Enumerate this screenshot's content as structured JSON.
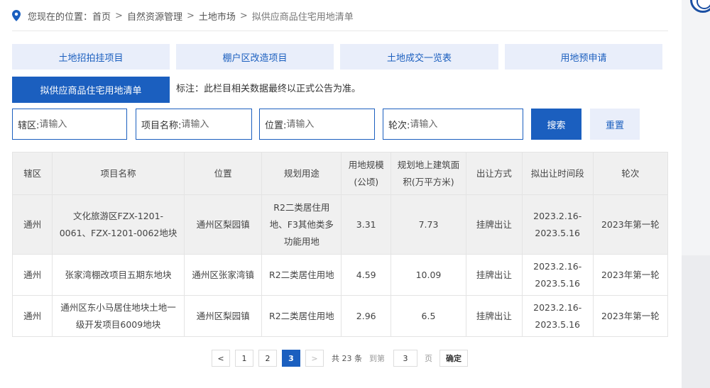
{
  "breadcrumb": {
    "prefix": "您现在的位置：",
    "items": [
      "首页",
      "自然资源管理",
      "土地市场"
    ],
    "current": "拟供应商品住宅用地清单",
    "separator": ">"
  },
  "tabs": [
    {
      "label": "土地招拍挂项目"
    },
    {
      "label": "棚户区改造项目"
    },
    {
      "label": "土地成交一览表"
    },
    {
      "label": "用地预申请"
    },
    {
      "label": "拟供应商品住宅用地清单",
      "active": true
    }
  ],
  "note": "标注：此栏目相关数据最终以正式公告为准。",
  "filters": [
    {
      "label": "辖区:",
      "placeholder": "请输入"
    },
    {
      "label": "项目名称:",
      "placeholder": "请输入"
    },
    {
      "label": "位置:",
      "placeholder": "请输入"
    },
    {
      "label": "轮次:",
      "placeholder": "请输入"
    }
  ],
  "buttons": {
    "search": "搜索",
    "reset": "重置"
  },
  "table": {
    "headers": [
      "辖区",
      "项目名称",
      "位置",
      "规划用途",
      "用地规模(公顷)",
      "规划地上建筑面积(万平方米)",
      "出让方式",
      "拟出让时间段",
      "轮次"
    ],
    "rows": [
      [
        "通州",
        "文化旅游区FZX-1201-0061、FZX-1201-0062地块",
        "通州区梨园镇",
        "R2二类居住用地、F3其他类多功能用地",
        "3.31",
        "7.73",
        "挂牌出让",
        "2023.2.16-2023.5.16",
        "2023年第一轮"
      ],
      [
        "通州",
        "张家湾棚改项目五期东地块",
        "通州区张家湾镇",
        "R2二类居住用地",
        "4.59",
        "10.09",
        "挂牌出让",
        "2023.2.16-2023.5.16",
        "2023年第一轮"
      ],
      [
        "通州",
        "通州区东小马居住地块土地一级开发项目6009地块",
        "通州区梨园镇",
        "R2二类居住用地",
        "2.96",
        "6.5",
        "挂牌出让",
        "2023.2.16-2023.5.16",
        "2023年第一轮"
      ]
    ]
  },
  "pagination": {
    "prev": "<",
    "pages": [
      "1",
      "2",
      "3"
    ],
    "current_page": "3",
    "next": ">",
    "total_text": "共 23 条",
    "goto_label": "到第",
    "goto_value": "3",
    "page_unit": "页",
    "confirm": "确定"
  },
  "colors": {
    "accent": "#1b5fbf",
    "tab_bg": "#e9eefa",
    "header_bg": "#f0f0f0"
  }
}
